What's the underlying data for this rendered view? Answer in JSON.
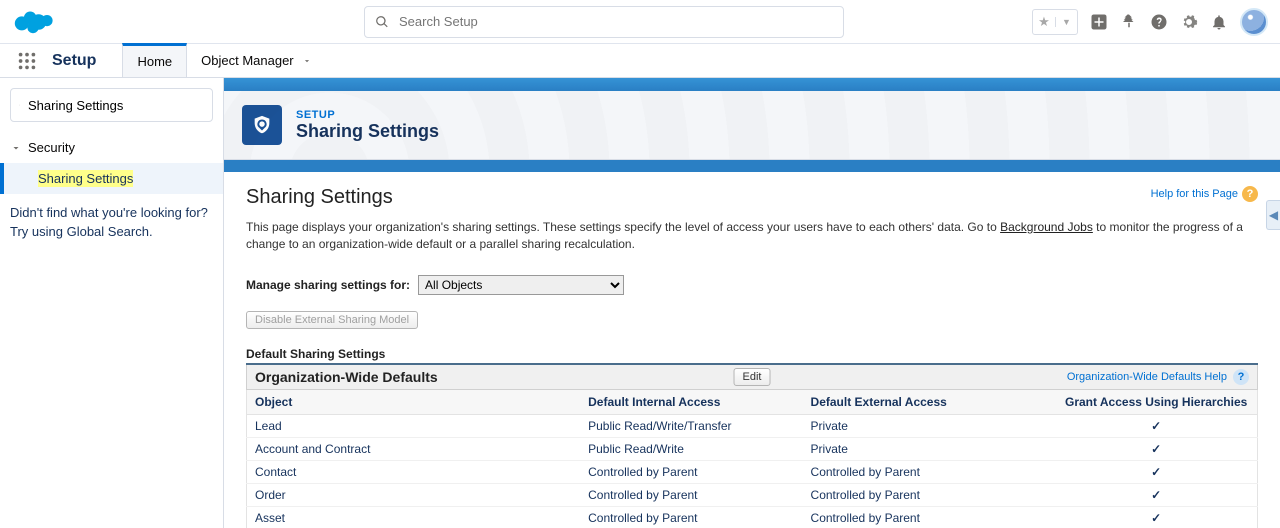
{
  "topbar": {
    "search_placeholder": "Search Setup"
  },
  "setupnav": {
    "title": "Setup",
    "tabs": {
      "home": "Home",
      "object_manager": "Object Manager"
    }
  },
  "sidebar": {
    "search_value": "Sharing Settings",
    "tree_parent": "Security",
    "tree_active": "Sharing Settings",
    "note_line1": "Didn't find what you're looking for?",
    "note_line2": "Try using Global Search."
  },
  "page_header": {
    "breadcrumb": "SETUP",
    "title": "Sharing Settings"
  },
  "content": {
    "h1": "Sharing Settings",
    "help_link": "Help for this Page",
    "desc_before": "This page displays your organization's sharing settings. These settings specify the level of access your users have to each others' data. Go to ",
    "desc_link": "Background Jobs",
    "desc_after": " to monitor the progress of a change to an organization-wide default or a parallel sharing recalculation.",
    "manage_label": "Manage sharing settings for:",
    "manage_selected": "All Objects",
    "btn_disable_ext": "Disable External Sharing Model",
    "section_default": "Default Sharing Settings",
    "owd_title": "Organization-Wide Defaults",
    "btn_edit": "Edit",
    "owd_help": "Organization-Wide Defaults Help",
    "columns": {
      "object": "Object",
      "internal": "Default Internal Access",
      "external": "Default External Access",
      "grant": "Grant Access Using Hierarchies"
    },
    "rows": [
      {
        "object": "Lead",
        "internal": "Public Read/Write/Transfer",
        "external": "Private",
        "grant": true
      },
      {
        "object": "Account and Contract",
        "internal": "Public Read/Write",
        "external": "Private",
        "grant": true
      },
      {
        "object": "Contact",
        "internal": "Controlled by Parent",
        "external": "Controlled by Parent",
        "grant": true
      },
      {
        "object": "Order",
        "internal": "Controlled by Parent",
        "external": "Controlled by Parent",
        "grant": true
      },
      {
        "object": "Asset",
        "internal": "Controlled by Parent",
        "external": "Controlled by Parent",
        "grant": true
      }
    ]
  }
}
